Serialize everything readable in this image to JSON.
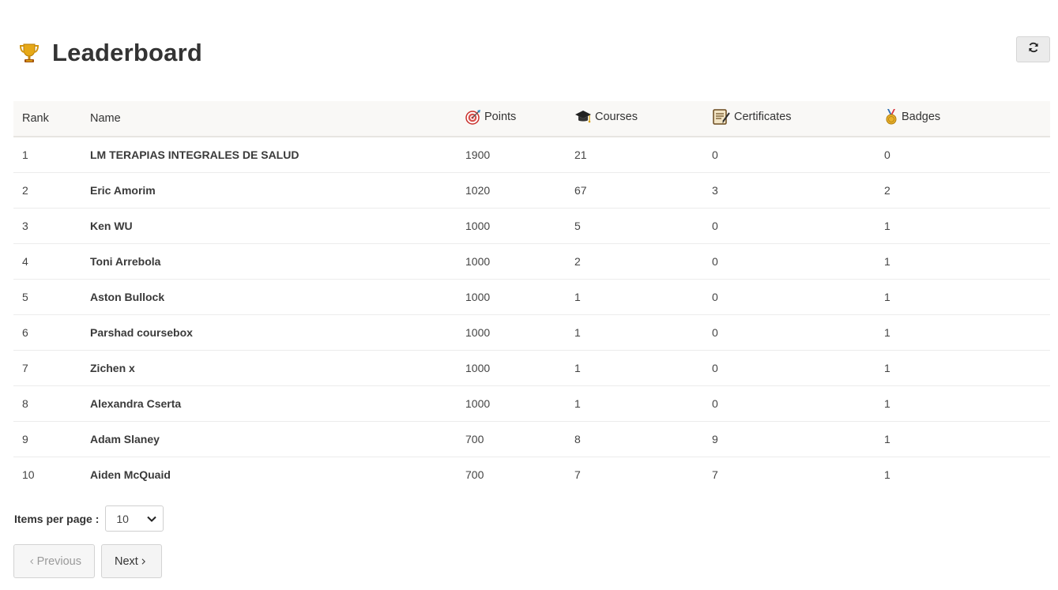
{
  "header": {
    "title": "Leaderboard",
    "trophy_icon": "trophy-icon",
    "refresh_icon": "refresh-icon"
  },
  "table": {
    "columns": {
      "rank": "Rank",
      "name": "Name",
      "points": "Points",
      "courses": "Courses",
      "certificates": "Certificates",
      "badges": "Badges"
    },
    "rows": [
      {
        "rank": "1",
        "name": "LM TERAPIAS INTEGRALES DE SALUD",
        "points": "1900",
        "courses": "21",
        "certificates": "0",
        "badges": "0"
      },
      {
        "rank": "2",
        "name": "Eric Amorim",
        "points": "1020",
        "courses": "67",
        "certificates": "3",
        "badges": "2"
      },
      {
        "rank": "3",
        "name": "Ken WU",
        "points": "1000",
        "courses": "5",
        "certificates": "0",
        "badges": "1"
      },
      {
        "rank": "4",
        "name": "Toni Arrebola",
        "points": "1000",
        "courses": "2",
        "certificates": "0",
        "badges": "1"
      },
      {
        "rank": "5",
        "name": "Aston Bullock",
        "points": "1000",
        "courses": "1",
        "certificates": "0",
        "badges": "1"
      },
      {
        "rank": "6",
        "name": "Parshad coursebox",
        "points": "1000",
        "courses": "1",
        "certificates": "0",
        "badges": "1"
      },
      {
        "rank": "7",
        "name": "Zichen x",
        "points": "1000",
        "courses": "1",
        "certificates": "0",
        "badges": "1"
      },
      {
        "rank": "8",
        "name": "Alexandra Cserta",
        "points": "1000",
        "courses": "1",
        "certificates": "0",
        "badges": "1"
      },
      {
        "rank": "9",
        "name": "Adam Slaney",
        "points": "700",
        "courses": "8",
        "certificates": "9",
        "badges": "1"
      },
      {
        "rank": "10",
        "name": "Aiden McQuaid",
        "points": "700",
        "courses": "7",
        "certificates": "7",
        "badges": "1"
      }
    ]
  },
  "pagination": {
    "items_per_page_label": "Items per page :",
    "items_per_page_value": "10",
    "previous_label": "Previous",
    "next_label": "Next"
  }
}
